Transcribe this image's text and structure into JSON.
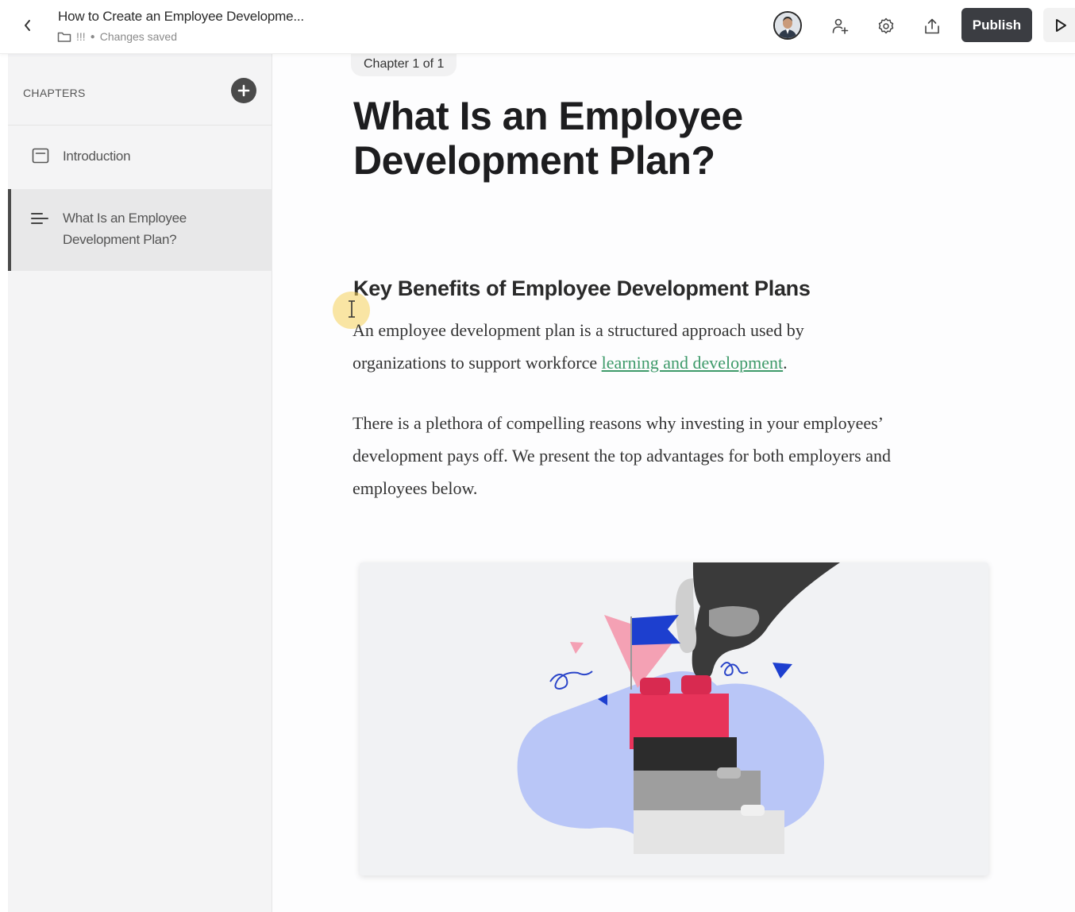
{
  "topbar": {
    "doc_title": "How to Create an Employee Developme...",
    "folder_name": "!!!",
    "save_status": "Changes saved",
    "publish_label": "Publish",
    "icons": [
      "chevron-left-icon",
      "folder-icon",
      "avatar",
      "add-user-icon",
      "gear-icon",
      "share-upload-icon",
      "play-icon"
    ]
  },
  "sidebar": {
    "header": "CHAPTERS",
    "items": [
      {
        "label": "Introduction",
        "icon": "page-icon",
        "active": false
      },
      {
        "label_line1": "What Is an Employee",
        "label_line2": "Development Plan?",
        "icon": "paragraph-lines-icon",
        "active": true
      }
    ]
  },
  "main": {
    "chapter_indicator": "Chapter 1 of 1",
    "title_line1": "What Is an Employee",
    "title_line2": "Development Plan?",
    "section_heading": "Key Benefits of Employee Development Plans",
    "para1_line1": "An employee development plan is a structured approach used by",
    "para1_line2_prefix": "organizations to support workforce ",
    "para1_link": "learning and development",
    "para1_suffix": ".",
    "para2_line1": "There is a plethora of compelling reasons why investing in your employees’",
    "para2_line2": "development pays off. We present the top advantages for both employers and",
    "para2_line3": "employees below.",
    "colors": {
      "link": "#3e9a6a",
      "publish_bg": "#3b3d42",
      "blob": "#b9c6f7",
      "brick_red": "#e8335a",
      "flag_blue": "#1d3fcf"
    }
  }
}
